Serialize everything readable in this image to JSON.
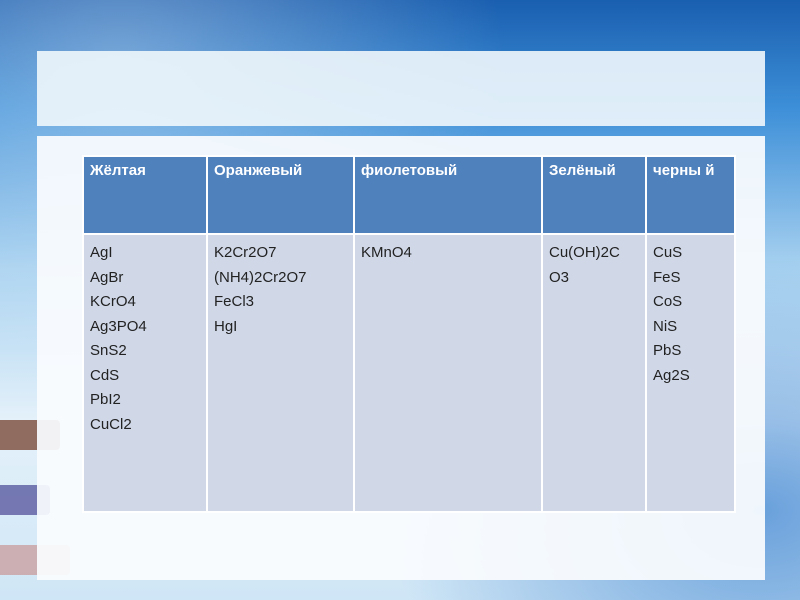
{
  "table": {
    "headers": [
      "Жёлтая",
      "Оранжевый",
      "фиолетовый",
      "Зелёный",
      "черны й"
    ],
    "columns": [
      [
        "AgI",
        "AgBr",
        "KCrO4",
        "Ag3PO4",
        "SnS2",
        "CdS",
        "PbI2",
        "CuCl2"
      ],
      [
        "K2Cr2O7",
        "(NH4)2Cr2O7",
        "FeCl3",
        "HgI"
      ],
      [
        "KMnO4"
      ],
      [
        "Cu(OH)2C",
        "O3"
      ],
      [
        "CuS",
        "FeS",
        "CoS",
        "NiS",
        "PbS",
        "Ag2S"
      ]
    ]
  },
  "colors": {
    "header_bg": "#4f81bd",
    "cell_bg": "#d0d8e8"
  }
}
